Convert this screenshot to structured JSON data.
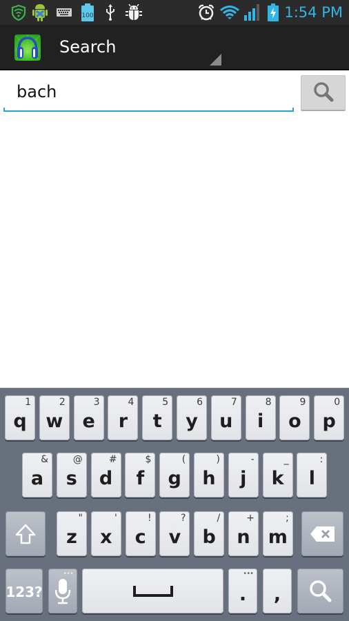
{
  "status_bar": {
    "left_icons": [
      "shield-wifi-icon",
      "android-app-icon",
      "keyboard-icon",
      "battery-100-icon",
      "usb-icon",
      "debug-bug-icon"
    ],
    "battery_notification_text": "100",
    "right_icons": [
      "alarm-clock-icon",
      "wifi-icon",
      "signal-icon",
      "battery-charging-icon"
    ],
    "time": "1:54 PM",
    "time_color": "#33b5e5"
  },
  "action_bar": {
    "app_icon": "headphones-app-icon",
    "title": "Search",
    "has_dropdown": true
  },
  "search": {
    "query": "bach",
    "placeholder": "",
    "button_icon": "search-icon",
    "underline_color": "#2a9fd6"
  },
  "keyboard": {
    "row1": [
      {
        "key": "q",
        "hint": "1"
      },
      {
        "key": "w",
        "hint": "2"
      },
      {
        "key": "e",
        "hint": "3"
      },
      {
        "key": "r",
        "hint": "4"
      },
      {
        "key": "t",
        "hint": "5"
      },
      {
        "key": "y",
        "hint": "6"
      },
      {
        "key": "u",
        "hint": "7"
      },
      {
        "key": "i",
        "hint": "8"
      },
      {
        "key": "o",
        "hint": "9"
      },
      {
        "key": "p",
        "hint": "0"
      }
    ],
    "row2": [
      {
        "key": "a",
        "hint": "&"
      },
      {
        "key": "s",
        "hint": "@"
      },
      {
        "key": "d",
        "hint": "#"
      },
      {
        "key": "f",
        "hint": "$"
      },
      {
        "key": "g",
        "hint": "("
      },
      {
        "key": "h",
        "hint": ")"
      },
      {
        "key": "j",
        "hint": "-"
      },
      {
        "key": "k",
        "hint": "_"
      },
      {
        "key": "l",
        "hint": ":"
      }
    ],
    "row3": [
      {
        "key": "z",
        "hint": "\""
      },
      {
        "key": "x",
        "hint": "'"
      },
      {
        "key": "c",
        "hint": "!"
      },
      {
        "key": "v",
        "hint": "?"
      },
      {
        "key": "b",
        "hint": "/"
      },
      {
        "key": "n",
        "hint": "+"
      },
      {
        "key": "m",
        "hint": ";"
      }
    ],
    "shift_icon": "shift-icon",
    "delete_icon": "backspace-icon",
    "symbols_label": "123?",
    "mic_icon": "microphone-icon",
    "space_icon": "space-bar-icon",
    "period": ".",
    "comma": ",",
    "more_dots": "•••",
    "search_icon": "search-icon"
  }
}
